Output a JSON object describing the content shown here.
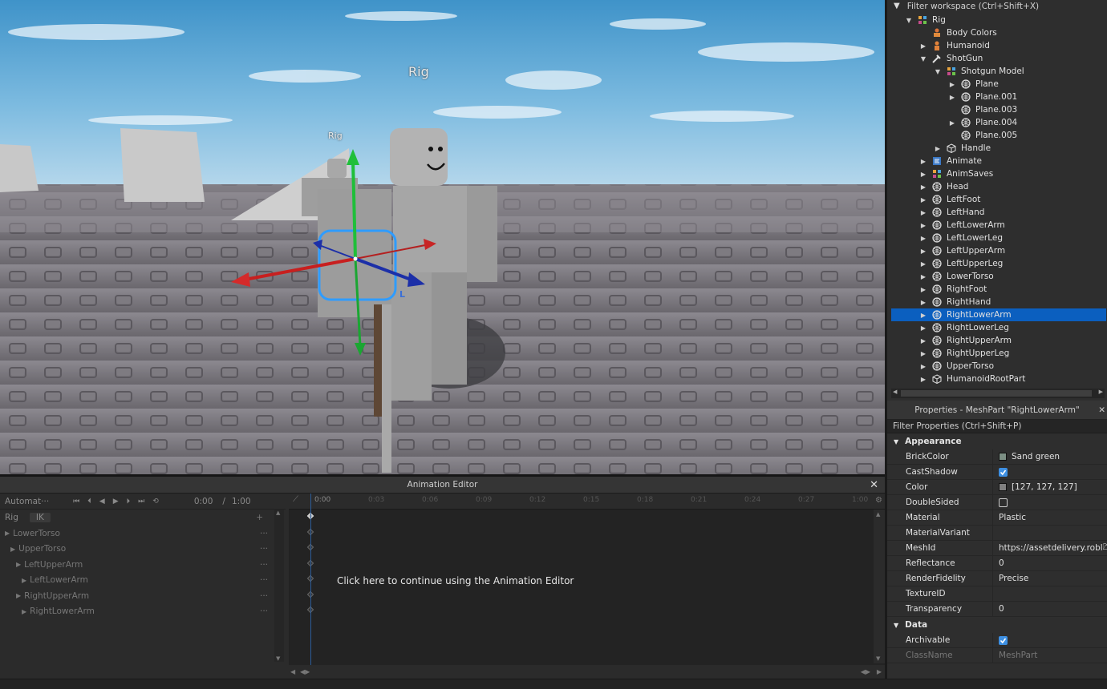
{
  "viewport": {
    "labels": {
      "rig_main": "Rig",
      "rig_small": "Rig",
      "local_marker": "L"
    }
  },
  "explorer": {
    "filter_placeholder": "Filter workspace (Ctrl+Shift+X)",
    "items": [
      {
        "label": "Rig",
        "depth": 0,
        "expanded": true,
        "icon": "model-icon"
      },
      {
        "label": "Body Colors",
        "depth": 1,
        "icon": "body-colors-icon"
      },
      {
        "label": "Humanoid",
        "depth": 1,
        "arrow": true,
        "icon": "humanoid-icon"
      },
      {
        "label": "ShotGun",
        "depth": 1,
        "expanded": true,
        "icon": "tool-icon"
      },
      {
        "label": "Shotgun Model",
        "depth": 2,
        "expanded": true,
        "icon": "model-icon"
      },
      {
        "label": "Plane",
        "depth": 3,
        "arrow": true,
        "icon": "meshpart-icon"
      },
      {
        "label": "Plane.001",
        "depth": 3,
        "arrow": true,
        "icon": "meshpart-icon"
      },
      {
        "label": "Plane.003",
        "depth": 3,
        "icon": "meshpart-icon"
      },
      {
        "label": "Plane.004",
        "depth": 3,
        "arrow": true,
        "icon": "meshpart-icon"
      },
      {
        "label": "Plane.005",
        "depth": 3,
        "icon": "meshpart-icon"
      },
      {
        "label": "Handle",
        "depth": 2,
        "arrow": true,
        "icon": "part-icon"
      },
      {
        "label": "Animate",
        "depth": 1,
        "arrow": true,
        "icon": "script-icon"
      },
      {
        "label": "AnimSaves",
        "depth": 1,
        "arrow": true,
        "icon": "model-icon"
      },
      {
        "label": "Head",
        "depth": 1,
        "arrow": true,
        "icon": "meshpart-icon"
      },
      {
        "label": "LeftFoot",
        "depth": 1,
        "arrow": true,
        "icon": "meshpart-icon"
      },
      {
        "label": "LeftHand",
        "depth": 1,
        "arrow": true,
        "icon": "meshpart-icon"
      },
      {
        "label": "LeftLowerArm",
        "depth": 1,
        "arrow": true,
        "icon": "meshpart-icon"
      },
      {
        "label": "LeftLowerLeg",
        "depth": 1,
        "arrow": true,
        "icon": "meshpart-icon"
      },
      {
        "label": "LeftUpperArm",
        "depth": 1,
        "arrow": true,
        "icon": "meshpart-icon"
      },
      {
        "label": "LeftUpperLeg",
        "depth": 1,
        "arrow": true,
        "icon": "meshpart-icon"
      },
      {
        "label": "LowerTorso",
        "depth": 1,
        "arrow": true,
        "icon": "meshpart-icon"
      },
      {
        "label": "RightFoot",
        "depth": 1,
        "arrow": true,
        "icon": "meshpart-icon"
      },
      {
        "label": "RightHand",
        "depth": 1,
        "arrow": true,
        "icon": "meshpart-icon"
      },
      {
        "label": "RightLowerArm",
        "depth": 1,
        "arrow": true,
        "icon": "meshpart-icon",
        "selected": true
      },
      {
        "label": "RightLowerLeg",
        "depth": 1,
        "arrow": true,
        "icon": "meshpart-icon"
      },
      {
        "label": "RightUpperArm",
        "depth": 1,
        "arrow": true,
        "icon": "meshpart-icon"
      },
      {
        "label": "RightUpperLeg",
        "depth": 1,
        "arrow": true,
        "icon": "meshpart-icon"
      },
      {
        "label": "UpperTorso",
        "depth": 1,
        "arrow": true,
        "icon": "meshpart-icon"
      },
      {
        "label": "HumanoidRootPart",
        "depth": 1,
        "arrow": true,
        "icon": "part-icon"
      }
    ]
  },
  "properties": {
    "title": "Properties - MeshPart \"RightLowerArm\"",
    "filter_placeholder": "Filter Properties (Ctrl+Shift+P)",
    "sections": {
      "appearance": "Appearance",
      "data": "Data"
    },
    "appearance_rows": [
      {
        "name": "BrickColor",
        "value": "Sand green",
        "swatch": "#7c8f84"
      },
      {
        "name": "CastShadow",
        "checkbox": true
      },
      {
        "name": "Color",
        "value": "[127, 127, 127]",
        "swatch": "#7f7f7f"
      },
      {
        "name": "DoubleSided",
        "checkbox": false
      },
      {
        "name": "Material",
        "value": "Plastic"
      },
      {
        "name": "MaterialVariant",
        "value": ""
      },
      {
        "name": "MeshId",
        "value": "https://assetdelivery.robl",
        "folder": true
      },
      {
        "name": "Reflectance",
        "value": "0"
      },
      {
        "name": "RenderFidelity",
        "value": "Precise"
      },
      {
        "name": "TextureID",
        "value": ""
      },
      {
        "name": "Transparency",
        "value": "0"
      }
    ],
    "data_rows": [
      {
        "name": "Archivable",
        "checkbox": true
      },
      {
        "name": "ClassName",
        "value": "MeshPart",
        "dim": true
      }
    ]
  },
  "anim": {
    "title": "Animation Editor",
    "toolbar": {
      "name": "Automat···",
      "time_current": "0:00",
      "time_sep": "/",
      "time_total": "1:00"
    },
    "rig_label": "Rig",
    "ik_label": "IK",
    "add_symbol": "+",
    "tracks": [
      {
        "label": "LowerTorso",
        "indent": 0
      },
      {
        "label": "UpperTorso",
        "indent": 1
      },
      {
        "label": "LeftUpperArm",
        "indent": 2
      },
      {
        "label": "LeftLowerArm",
        "indent": 3
      },
      {
        "label": "RightUpperArm",
        "indent": 2
      },
      {
        "label": "RightLowerArm",
        "indent": 3
      }
    ],
    "ticks": [
      "0:00",
      "0:03",
      "0:06",
      "0:09",
      "0:12",
      "0:15",
      "0:18",
      "0:21",
      "0:24",
      "0:27",
      "1:00"
    ],
    "overlay_message": "Click here to continue using the Animation Editor"
  },
  "colors": {
    "selection": "#0b5fbf",
    "panel_bg": "#2e2e2e",
    "checkbox_on": "#3d8fe2",
    "gizmo_x": "#d42a2a",
    "gizmo_y": "#1fbf3a",
    "gizmo_z": "#1c2fa8"
  }
}
